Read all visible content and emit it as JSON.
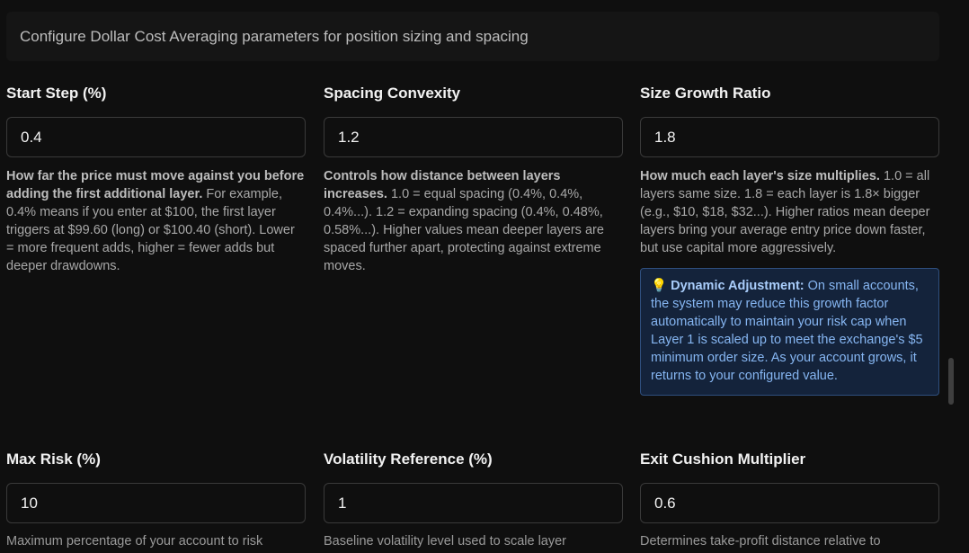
{
  "banner_text": "Configure Dollar Cost Averaging parameters for position sizing and spacing",
  "fields": [
    {
      "label": "Start Step (%)",
      "value": "0.4",
      "help_bold": "How far the price must move against you before adding the first additional layer.",
      "help_text": " For example, 0.4% means if you enter at $100, the first layer triggers at $99.60 (long) or $100.40 (short). Lower = more frequent adds, higher = fewer adds but deeper drawdowns."
    },
    {
      "label": "Spacing Convexity",
      "value": "1.2",
      "help_bold": "Controls how distance between layers increases.",
      "help_text": " 1.0 = equal spacing (0.4%, 0.4%, 0.4%...). 1.2 = expanding spacing (0.4%, 0.48%, 0.58%...). Higher values mean deeper layers are spaced further apart, protecting against extreme moves."
    },
    {
      "label": "Size Growth Ratio",
      "value": "1.8",
      "help_bold": "How much each layer's size multiplies.",
      "help_text": " 1.0 = all layers same size. 1.8 = each layer is 1.8× bigger (e.g., $10, $18, $32...). Higher ratios mean deeper layers bring your average entry price down faster, but use capital more aggressively.",
      "callout_icon": "💡",
      "callout_title": "Dynamic Adjustment:",
      "callout_text": " On small accounts, the system may reduce this growth factor automatically to maintain your risk cap when Layer 1 is scaled up to meet the exchange's $5 minimum order size. As your account grows, it returns to your configured value."
    },
    {
      "label": "Max Risk (%)",
      "value": "10",
      "help_text": "Maximum percentage of your account to risk"
    },
    {
      "label": "Volatility Reference (%)",
      "value": "1",
      "help_text": "Baseline volatility level used to scale layer"
    },
    {
      "label": "Exit Cushion Multiplier",
      "value": "0.6",
      "help_text": "Determines take-profit distance relative to"
    }
  ]
}
